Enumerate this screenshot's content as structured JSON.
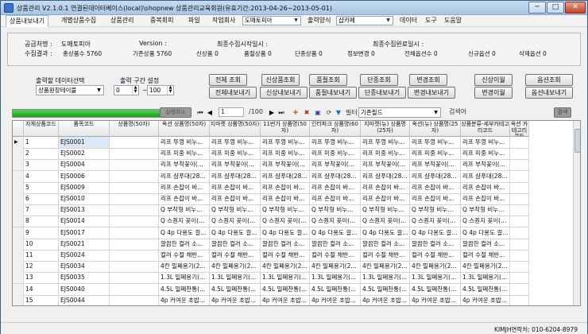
{
  "window": {
    "title": "상품관리 V2.1.0.1 연결된데이터베이스(local)\\shopnew 상품관리교육회원(유효기간:2013-04-26~2013-05-01)",
    "min": "─",
    "max": "□",
    "close": "✕"
  },
  "menu": {
    "tabs": [
      "상품내보내기",
      "개별상품수집",
      "상품관리",
      "중복회피",
      "파일",
      "작업회사"
    ],
    "company_value": "도매토피아",
    "output_label": "출력양식",
    "output_value": "샵카페",
    "items": [
      "데이터",
      "도구",
      "도움말"
    ]
  },
  "info": {
    "supplier_label": "공급처명 :",
    "supplier_value": "도매토피아",
    "version_label": "Version :",
    "version_value": "",
    "last_start_label": "최종수집시작일시 :",
    "last_start_value": "",
    "last_end_label": "최종수집완료일시 :",
    "last_end_value": "",
    "result_label": "수집결과 :",
    "stats": [
      {
        "label": "총상품수",
        "value": "5760"
      },
      {
        "label": "기존상품",
        "value": "5760"
      },
      {
        "label": "신상품",
        "value": "0"
      },
      {
        "label": "품절상품",
        "value": "0"
      },
      {
        "label": "단종상품",
        "value": "0"
      },
      {
        "label": "정보변경",
        "value": "0"
      },
      {
        "label": "전체옵션수",
        "value": "0"
      },
      {
        "label": "신규옵션",
        "value": "0"
      },
      {
        "label": "삭제옵션",
        "value": "0"
      }
    ]
  },
  "controls": {
    "output_data_label": "출력할 데이터선택",
    "output_data_value": "상품원장테이블",
    "range_label": "출력 구간 설정",
    "range_from": "0",
    "range_to": "100",
    "buttons_row1": [
      "전체 조회",
      "신상품조회",
      "품절조회",
      "단종조회",
      "변경조회"
    ],
    "buttons_row2": [
      "전체내보내기",
      "신상내보내기",
      "품절내보내기",
      "단종내보내기",
      "변경내보내기"
    ],
    "side_buttons_row1": [
      "신상이월",
      "옵션조회"
    ],
    "side_buttons_row2": [
      "변경이월",
      "옵션내보내기"
    ]
  },
  "nav": {
    "cancel_label": "실행취소",
    "progress_fraction": 0.93,
    "page_value": "1",
    "page_total": "/100",
    "filter_label": "필터",
    "filter_value": "기존필드",
    "search_value": "검색어",
    "search_button": "검색"
  },
  "grid": {
    "columns": [
      "관리번호",
      "자체상품코드",
      "품목코드",
      "상품명(50자)",
      "옥션 상품명(50자)",
      "지마켓 상품명(50자)",
      "11번가 상품명(50자)",
      "인터파크 상품명(60자)",
      "지마켓(뉴) 상품명(25자)",
      "옥션(뉴) 상품명(25자)",
      "상품분류-세부카테고리코드",
      "옥션 카테고리코드"
    ],
    "rows": [
      {
        "n": "1",
        "code": "EJS0001",
        "name": "리프 뚜껑 비누..."
      },
      {
        "n": "2",
        "code": "EJS0002",
        "name": "리프 미중 비누..."
      },
      {
        "n": "3",
        "code": "EJS0004",
        "name": "리프 부착꽃이(..."
      },
      {
        "n": "4",
        "code": "EJS0006",
        "name": "리프 샴푸대(28..."
      },
      {
        "n": "5",
        "code": "EJS0009",
        "name": "리프 손잡이 바..."
      },
      {
        "n": "6",
        "code": "EJS0010",
        "name": "리프 손잡이 바..."
      },
      {
        "n": "7",
        "code": "EJS0013",
        "name": "Q 부착형 비누..."
      },
      {
        "n": "8",
        "code": "EJS0014",
        "name": "Q 스퀀지 꽂이(..."
      },
      {
        "n": "9",
        "code": "EJS0017",
        "name": "Q 4p 다용도 걸..."
      },
      {
        "n": "10",
        "code": "EJS0021",
        "name": "깔끔한 컬러 소..."
      },
      {
        "n": "11",
        "code": "EJS0024",
        "name": "컬러 수절 채반..."
      },
      {
        "n": "12",
        "code": "EJS0034",
        "name": "4칸 밀폐용기(2..."
      },
      {
        "n": "13",
        "code": "EJS0035",
        "name": "1.3L 밀폐용기(..."
      },
      {
        "n": "14",
        "code": "EJS0040",
        "name": "4.5L 밀폐찬통(..."
      },
      {
        "n": "15",
        "code": "EJS0044",
        "name": "4p 커여운 초밥..."
      }
    ],
    "row_pointer": "▶"
  },
  "status": {
    "text": "KIMJH연락처: 010-6204-8979"
  },
  "icons": [
    "app-icon",
    "first-page-icon",
    "prev-page-icon",
    "next-page-icon",
    "last-page-icon",
    "add-icon",
    "delete-icon",
    "save-icon",
    "refresh-icon",
    "filter-icon",
    "dropdown-arrow-icon"
  ]
}
